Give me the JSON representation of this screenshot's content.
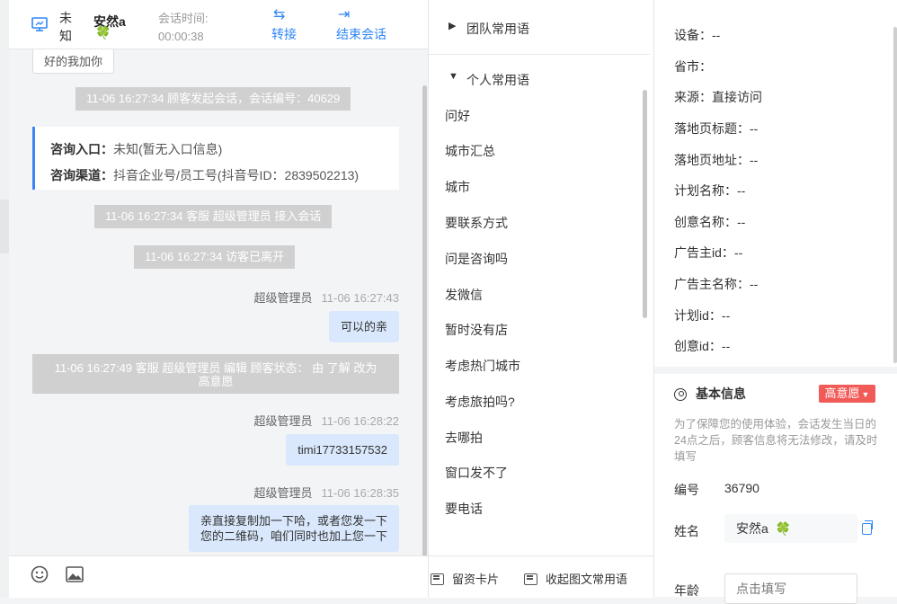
{
  "header": {
    "visitor_unknown": "未知",
    "agent_name": "安然a",
    "agent_emoji": "🍀",
    "session_time_label": "会话时间:",
    "session_time_value": "00:00:38",
    "transfer_label": "转接",
    "end_label": "结束会话"
  },
  "messages": {
    "top_chip": "好的我加你",
    "sys_start": "11-06 16:27:34 顾客发起会话，会话编号：40629",
    "info_card": {
      "entry_label": "咨询入口：",
      "entry_value": "未知(暂无入口信息)",
      "channel_label": "咨询渠道：",
      "channel_value": "抖音企业号/员工号(抖音号ID：2839502213)"
    },
    "sys_join": "11-06 16:27:34 客服 超级管理员 接入会话",
    "sys_left": "11-06 16:27:34 访客已离开",
    "msg1": {
      "sender": "超级管理员",
      "time": "11-06 16:27:43",
      "text": "可以的亲"
    },
    "sys_edit_line1": "11-06 16:27:49 客服 超级管理员 编辑 顾客状态： 由 了解 改为",
    "sys_edit_line2": "高意愿",
    "msg2": {
      "sender": "超级管理员",
      "time": "11-06 16:28:22",
      "text": "timi17733157532"
    },
    "msg3": {
      "sender": "超级管理员",
      "time": "11-06 16:28:35",
      "line1": "亲直接复制加一下哈，或者您发一下",
      "line2": "您的二维码，咱们同时也加上您一下"
    }
  },
  "phrases": {
    "team_group": "团队常用语",
    "personal_group": "个人常用语",
    "items": [
      "问好",
      "城市汇总",
      "城市",
      "要联系方式",
      "问是咨询吗",
      "发微信",
      "暂时没有店",
      "考虑热门城市",
      "考虑旅拍吗?",
      "去哪拍",
      "窗口发不了",
      "要电话"
    ],
    "card_label": "留资卡片",
    "collapse_label": "收起图文常用语"
  },
  "customer": {
    "rows": [
      {
        "label": "设备：",
        "value": "--"
      },
      {
        "label": "省市：",
        "value": ""
      },
      {
        "label": "来源：",
        "value": "直接访问"
      },
      {
        "label": "落地页标题：",
        "value": "--"
      },
      {
        "label": "落地页地址：",
        "value": "--"
      },
      {
        "label": "计划名称：",
        "value": "--"
      },
      {
        "label": "创意名称：",
        "value": "--"
      },
      {
        "label": "广告主id：",
        "value": "--"
      },
      {
        "label": "广告主名称：",
        "value": "--"
      },
      {
        "label": "计划id：",
        "value": "--"
      },
      {
        "label": "创意id：",
        "value": "--"
      }
    ],
    "basic_title": "基本信息",
    "intent_badge": "高意愿",
    "notice": "为了保障您的使用体验，会话发生当日的24点之后，顾客信息将无法修改，请及时填写",
    "id_label": "编号",
    "id_value": "36790",
    "name_label": "姓名",
    "name_value": "安然a",
    "name_emoji": "🍀",
    "age_label": "年龄",
    "age_placeholder": "点击填写"
  },
  "colors": {
    "accent": "#2f86f6",
    "bubble": "#d9e8fc",
    "system_chip": "#d0d0d0",
    "badge": "#f05b58"
  }
}
